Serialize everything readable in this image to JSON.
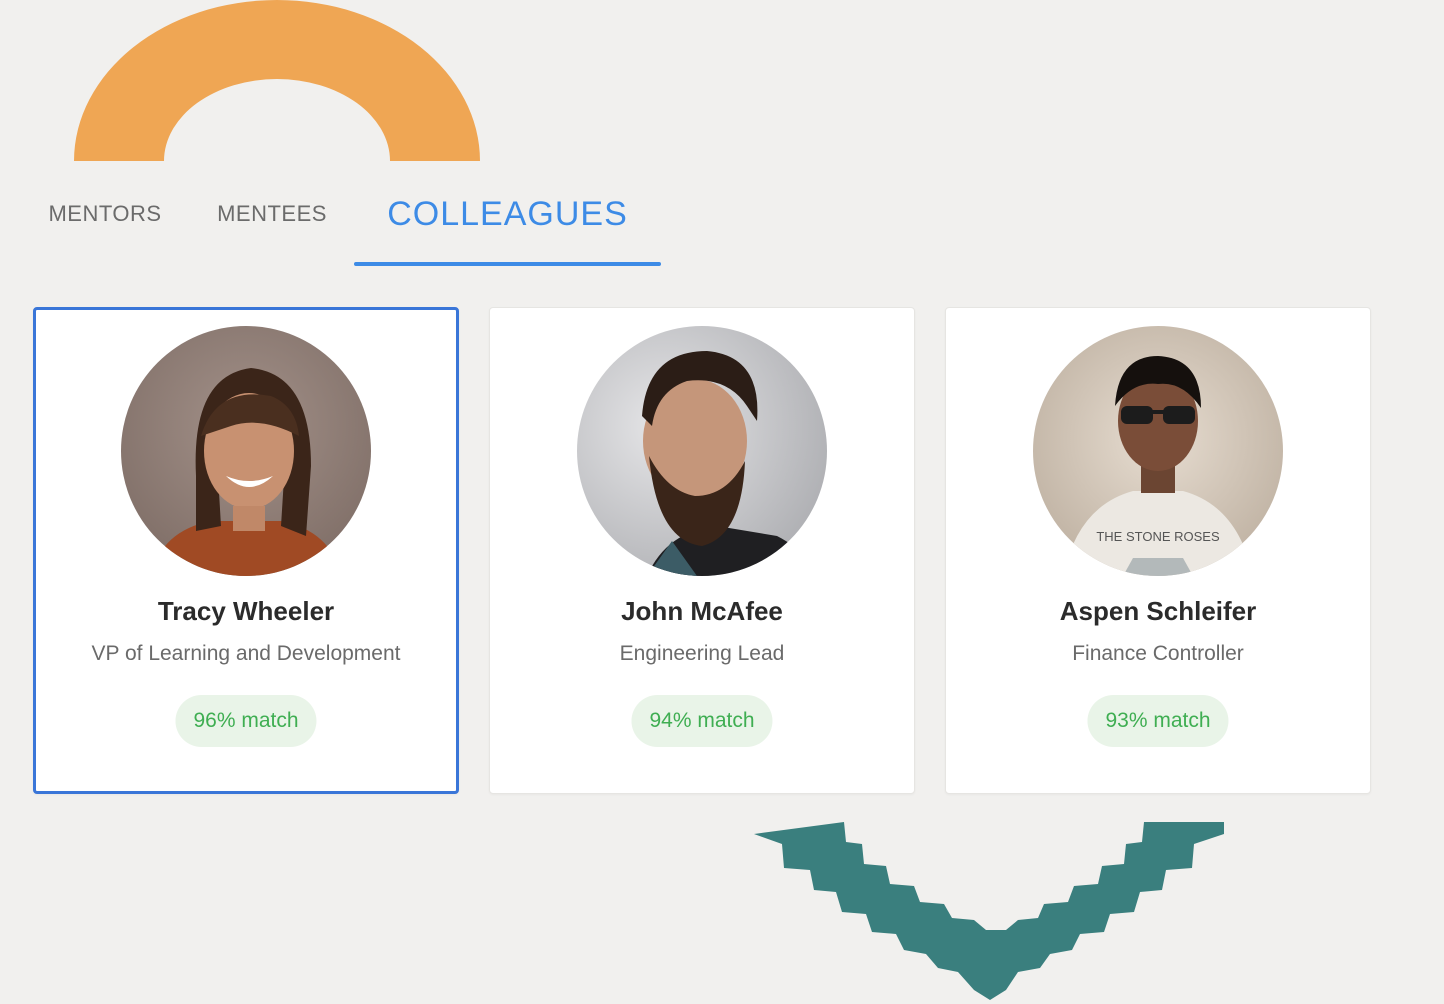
{
  "tabs": [
    {
      "label": "MENTORS"
    },
    {
      "label": "MENTEES"
    },
    {
      "label": "COLLEAGUES",
      "active": true
    }
  ],
  "cards": [
    {
      "name": "Tracy Wheeler",
      "role": "VP of Learning and Development",
      "match": "96% match",
      "selected": true
    },
    {
      "name": "John McAfee",
      "role": "Engineering Lead",
      "match": "94% match",
      "selected": false
    },
    {
      "name": "Aspen Schleifer",
      "role": "Finance Controller",
      "match": "93% match",
      "selected": false,
      "shirt_text": "THE STONE ROSES"
    }
  ],
  "colors": {
    "accent": "#3d8be6",
    "selected_border": "#3a76d8",
    "match_text": "#3fae52",
    "match_bg": "#e9f4e8",
    "arch": "#efa654",
    "zigzag": "#3a7f7e",
    "background": "#f1f0ee"
  }
}
